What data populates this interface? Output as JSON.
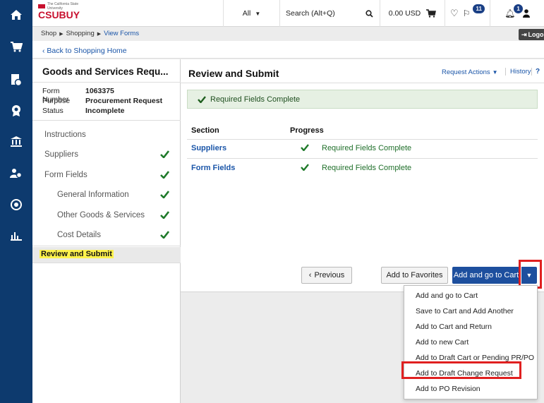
{
  "header": {
    "logo_text": "CSUBUY",
    "logo_small": "The California State University",
    "search_scope": "All",
    "search_placeholder": "Search (Alt+Q)",
    "cart_amount": "0.00 USD",
    "notifications_count": "11",
    "user_badge_count": "1",
    "logout_label": "Logou"
  },
  "breadcrumb": [
    "Shop",
    "Shopping",
    "View Forms"
  ],
  "back_link": "‹ Back to Shopping Home",
  "form": {
    "title": "Goods and Services Requ...",
    "meta": [
      {
        "key": "Form Number",
        "value": "1063375"
      },
      {
        "key": "Purpose",
        "value": "Procurement Request"
      },
      {
        "key": "Status",
        "value": "Incomplete"
      }
    ],
    "nav": [
      {
        "label": "Instructions",
        "checked": false,
        "sub": false
      },
      {
        "label": "Suppliers",
        "checked": true,
        "sub": false
      },
      {
        "label": "Form Fields",
        "checked": true,
        "sub": false
      },
      {
        "label": "General Information",
        "checked": true,
        "sub": true
      },
      {
        "label": "Other Goods & Services",
        "checked": true,
        "sub": true
      },
      {
        "label": "Cost Details",
        "checked": true,
        "sub": true
      }
    ],
    "active_nav": "Review and Submit"
  },
  "main": {
    "title": "Review and Submit",
    "request_actions": "Request Actions",
    "history": "History",
    "help": "?",
    "banner": "Required Fields Complete",
    "columns": [
      "Section",
      "Progress"
    ],
    "rows": [
      {
        "section": "Suppliers",
        "progress": "Required Fields Complete"
      },
      {
        "section": "Form Fields",
        "progress": "Required Fields Complete"
      }
    ],
    "buttons": {
      "previous": "Previous",
      "favorites": "Add to Favorites",
      "add_go_cart": "Add and go to Cart"
    }
  },
  "dropdown_items": [
    "Add and go to Cart",
    "Save to Cart and Add Another",
    "Add to Cart and Return",
    "Add to new Cart",
    "Add to Draft Cart or Pending PR/PO",
    "Add to Draft Change Request",
    "Add to PO Revision"
  ],
  "colors": {
    "rail": "#0d3a6e",
    "primary_button": "#1d4f9e",
    "check_green": "#1f7a2a",
    "highlight": "#fff34d",
    "annotation_red": "#e02020"
  }
}
